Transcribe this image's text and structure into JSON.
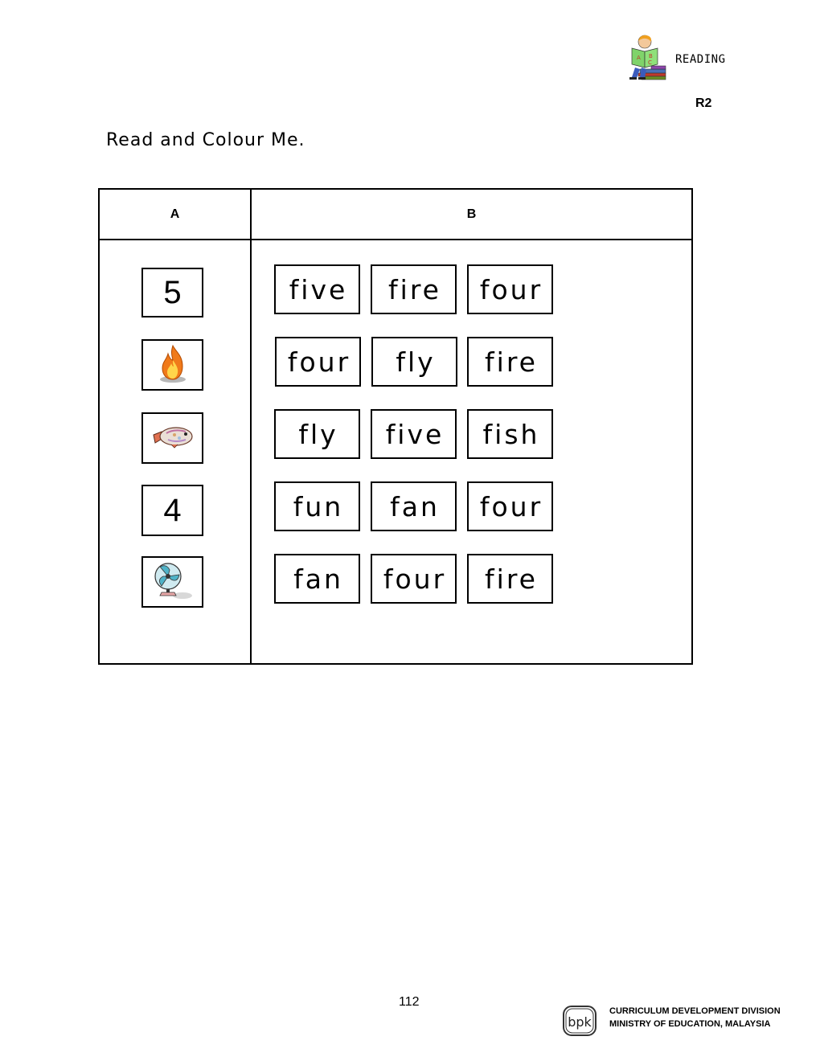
{
  "header": {
    "section_label": "READING",
    "code": "R2",
    "section_icon": "child-reading-books-icon"
  },
  "instruction": "Read and Colour Me.",
  "table": {
    "columns": [
      "A",
      "B"
    ],
    "rows": [
      {
        "clue": {
          "type": "number",
          "value": "5",
          "icon": ""
        },
        "choices": [
          "five",
          "fire",
          "four"
        ]
      },
      {
        "clue": {
          "type": "picture",
          "value": "",
          "icon": "fire-icon"
        },
        "choices": [
          "four",
          "fly",
          "fire"
        ]
      },
      {
        "clue": {
          "type": "picture",
          "value": "",
          "icon": "fish-icon"
        },
        "choices": [
          "fly",
          "five",
          "fish"
        ]
      },
      {
        "clue": {
          "type": "number",
          "value": "4",
          "icon": ""
        },
        "choices": [
          "fun",
          "fan",
          "four"
        ]
      },
      {
        "clue": {
          "type": "picture",
          "value": "",
          "icon": "fan-icon"
        },
        "choices": [
          "fan",
          "four",
          "fire"
        ]
      }
    ]
  },
  "footer": {
    "page_number": "112",
    "logo_text": "bpk",
    "org_line1": "CURRICULUM DEVELOPMENT DIVISION",
    "org_line2": "MINISTRY OF EDUCATION, MALAYSIA"
  }
}
